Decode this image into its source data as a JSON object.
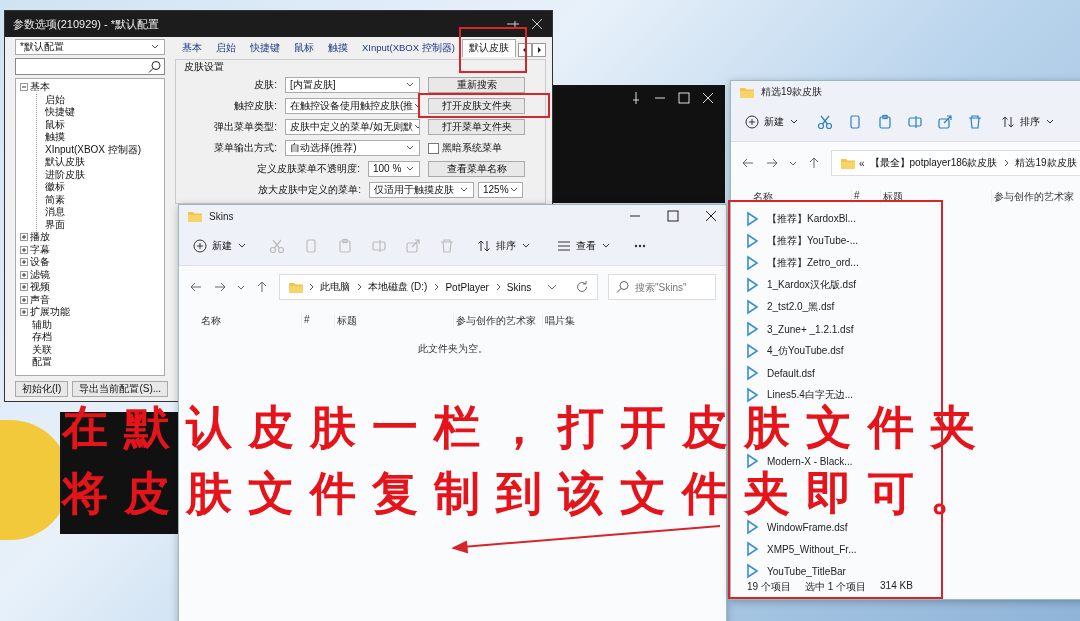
{
  "preferences": {
    "title": "参数选项(210929) - *默认配置",
    "profile": "*默认配置",
    "tree": [
      {
        "label": "基本",
        "kind": "group",
        "expanded": true,
        "children": [
          {
            "label": "启始"
          },
          {
            "label": "快捷键"
          },
          {
            "label": "鼠标"
          },
          {
            "label": "触摸"
          },
          {
            "label": "XInput(XBOX 控制器)"
          },
          {
            "label": "默认皮肤"
          },
          {
            "label": "进阶皮肤"
          },
          {
            "label": "徽标"
          },
          {
            "label": "简素"
          },
          {
            "label": "消息"
          },
          {
            "label": "界面"
          }
        ]
      },
      {
        "label": "播放",
        "kind": "group",
        "expanded": false
      },
      {
        "label": "字幕",
        "kind": "group",
        "expanded": false
      },
      {
        "label": "设备",
        "kind": "group",
        "expanded": false
      },
      {
        "label": "滤镜",
        "kind": "group",
        "expanded": false
      },
      {
        "label": "视频",
        "kind": "group",
        "expanded": false
      },
      {
        "label": "声音",
        "kind": "group",
        "expanded": false
      },
      {
        "label": "扩展功能",
        "kind": "group",
        "expanded": false
      },
      {
        "label": "辅助",
        "kind": "leaf"
      },
      {
        "label": "存档",
        "kind": "leaf"
      },
      {
        "label": "关联",
        "kind": "leaf"
      },
      {
        "label": "配置",
        "kind": "leaf"
      }
    ],
    "tabs": [
      {
        "label": "基本",
        "selected": false
      },
      {
        "label": "启始",
        "selected": false
      },
      {
        "label": "快捷键",
        "selected": false
      },
      {
        "label": "鼠标",
        "selected": false
      },
      {
        "label": "触摸",
        "selected": false
      },
      {
        "label": "XInput(XBOX 控制器)",
        "selected": false
      },
      {
        "label": "默认皮肤",
        "selected": true
      }
    ],
    "section_title": "皮肤设置",
    "rows": [
      {
        "kind": "button",
        "label": "皮肤:",
        "value": "[内置皮肤]",
        "button": "重新搜索"
      },
      {
        "kind": "button",
        "label": "触控皮肤:",
        "value": "在触控设备使用触控皮肤(推",
        "button": "打开皮肤文件夹"
      },
      {
        "kind": "button",
        "label": "弹出菜单类型:",
        "value": "皮肤中定义的菜单/如无则默",
        "button": "打开菜单文件夹"
      },
      {
        "kind": "checkbox",
        "label": "菜单输出方式:",
        "value": "自动选择(推荐)",
        "checkbox": {
          "label": "黑暗系统菜单",
          "checked": false
        }
      },
      {
        "kind": "small-button",
        "label": "定义皮肤菜单不透明度:",
        "value": "100 %",
        "button": "查看菜单名称"
      },
      {
        "kind": "pair",
        "label": "放大皮肤中定义的菜单:",
        "value": "仅适用于触摸皮肤",
        "value_2": "125%"
      }
    ],
    "footer_buttons": [
      "初始化(I)",
      "导出当前配置(S)..."
    ]
  },
  "skins_window": {
    "title": "Skins",
    "actions_enabled": false,
    "toolbar": {
      "new": "新建",
      "sort": "排序",
      "view": "查看"
    },
    "path": [
      "此电脑",
      "本地磁盘 (D:)",
      "PotPlayer",
      "Skins"
    ],
    "search_placeholder": "搜索\"Skins\"",
    "columns": [
      "名称",
      "#",
      "标题",
      "参与创作的艺术家",
      "唱片集"
    ],
    "empty_text": "此文件夹为空。"
  },
  "skins_source_window": {
    "title": "精选19款皮肤",
    "actions_enabled": true,
    "toolbar": {
      "new": "新建",
      "sort": "排序"
    },
    "path_prefix": "«",
    "path": [
      "【最全】potplayer186款皮肤",
      "精选19款皮肤"
    ],
    "columns": [
      "名称",
      "#",
      "标题",
      "参与创作的艺术家"
    ],
    "files": [
      {
        "kind": "file",
        "name": "【推荐】KardoxBl..."
      },
      {
        "kind": "file",
        "name": "【推荐】YouTube-..."
      },
      {
        "kind": "file",
        "name": "【推荐】Zetro_ord..."
      },
      {
        "kind": "file",
        "name": "1_Kardox汉化版.dsf"
      },
      {
        "kind": "file",
        "name": "2_tst2.0_黑.dsf"
      },
      {
        "kind": "file",
        "name": "3_Zune+ _1.2.1.dsf"
      },
      {
        "kind": "file",
        "name": "4_仿YouTube.dsf"
      },
      {
        "kind": "file",
        "name": "Default.dsf"
      },
      {
        "kind": "file",
        "name": "Lines5.4白字无边..."
      },
      {
        "kind": "covered"
      },
      {
        "kind": "covered"
      },
      {
        "kind": "file",
        "name": "Modern-X - Black..."
      },
      {
        "kind": "covered"
      },
      {
        "kind": "covered"
      },
      {
        "kind": "file",
        "name": "WindowFrame.dsf"
      },
      {
        "kind": "file",
        "name": "XMP5_Without_Fr..."
      },
      {
        "kind": "file",
        "name": "YouTube_TitleBar"
      }
    ],
    "status": [
      "19 个项目",
      "选中 1 个项目",
      "314 KB"
    ]
  },
  "caption_lines": [
    "在默认皮肤一栏，打开皮肤文件夹",
    "将皮肤文件复制到该文件夹即可。"
  ]
}
